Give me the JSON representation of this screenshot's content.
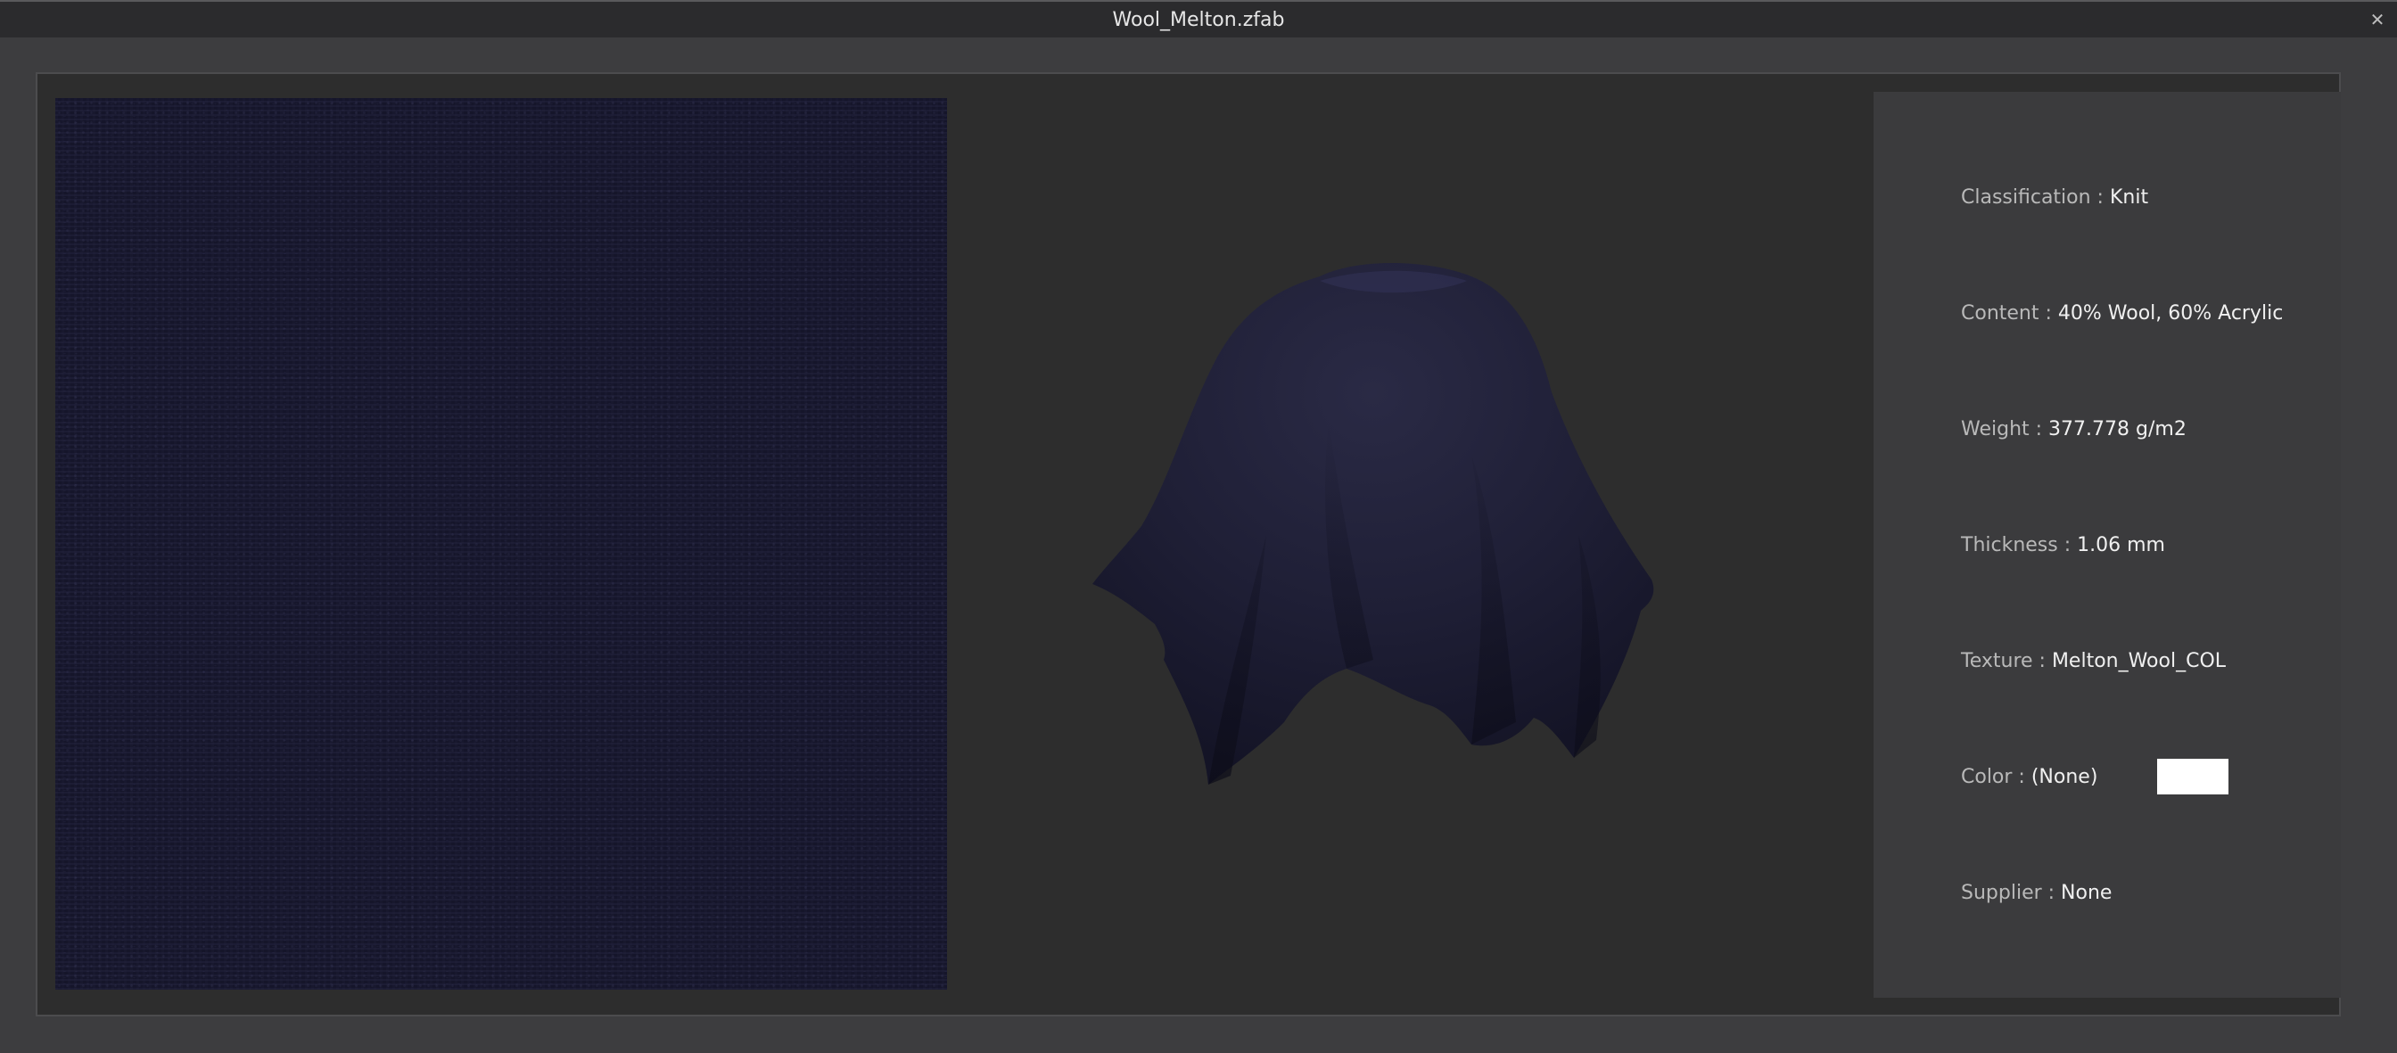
{
  "window": {
    "title": "Wool_Melton.zfab",
    "close_glyph": "✕"
  },
  "info": {
    "classification": {
      "label": "Classification : ",
      "value": "Knit"
    },
    "content": {
      "label": "Content : ",
      "value": "40% Wool, 60% Acrylic"
    },
    "weight": {
      "label": "Weight : ",
      "value": "377.778 g/m2"
    },
    "thickness": {
      "label": "Thickness : ",
      "value": "1.06 mm"
    },
    "texture": {
      "label": "Texture : ",
      "value": "Melton_Wool_COL"
    },
    "color": {
      "label": "Color : ",
      "value": "(None)",
      "swatch": "#ffffff"
    },
    "supplier": {
      "label": "Supplier : ",
      "value": "None"
    }
  },
  "colors": {
    "fabric": "#1c1c33",
    "background": "#2d2d2d",
    "panel": "#3b3b3d"
  }
}
